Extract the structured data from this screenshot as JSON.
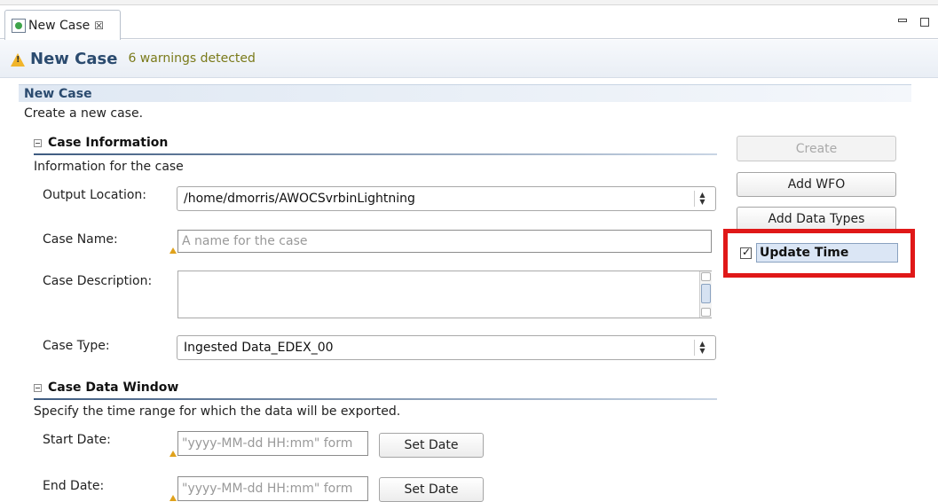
{
  "tab": {
    "label": "New Case",
    "close": "☒"
  },
  "header": {
    "title": "New Case",
    "warnings": "6 warnings detected"
  },
  "section": {
    "title": "New Case",
    "description": "Create a new case."
  },
  "case_info": {
    "title": "Case Information",
    "description": "Information for the case",
    "output_location_label": "Output Location:",
    "output_location_value": "/home/dmorris/AWOCSvrbinLightning",
    "case_name_label": "Case Name:",
    "case_name_placeholder": "A name for the case",
    "case_description_label": "Case Description:",
    "case_type_label": "Case Type:",
    "case_type_value": "Ingested Data_EDEX_00"
  },
  "data_window": {
    "title": "Case Data Window",
    "description": "Specify the time range for which the data will be exported.",
    "start_date_label": "Start Date:",
    "start_date_placeholder": "\"yyyy-MM-dd HH:mm\" form",
    "end_date_label": "End Date:",
    "end_date_placeholder": "\"yyyy-MM-dd HH:mm\" form",
    "set_date_label": "Set Date"
  },
  "actions": {
    "create_label": "Create",
    "add_wfo_label": "Add WFO",
    "add_data_types_label": "Add Data Types",
    "update_time_label": "Update Time",
    "update_time_checked": true
  },
  "colors": {
    "highlight": "#e01818",
    "title": "#2b4b6f",
    "warning_text": "#7a7a1a"
  }
}
